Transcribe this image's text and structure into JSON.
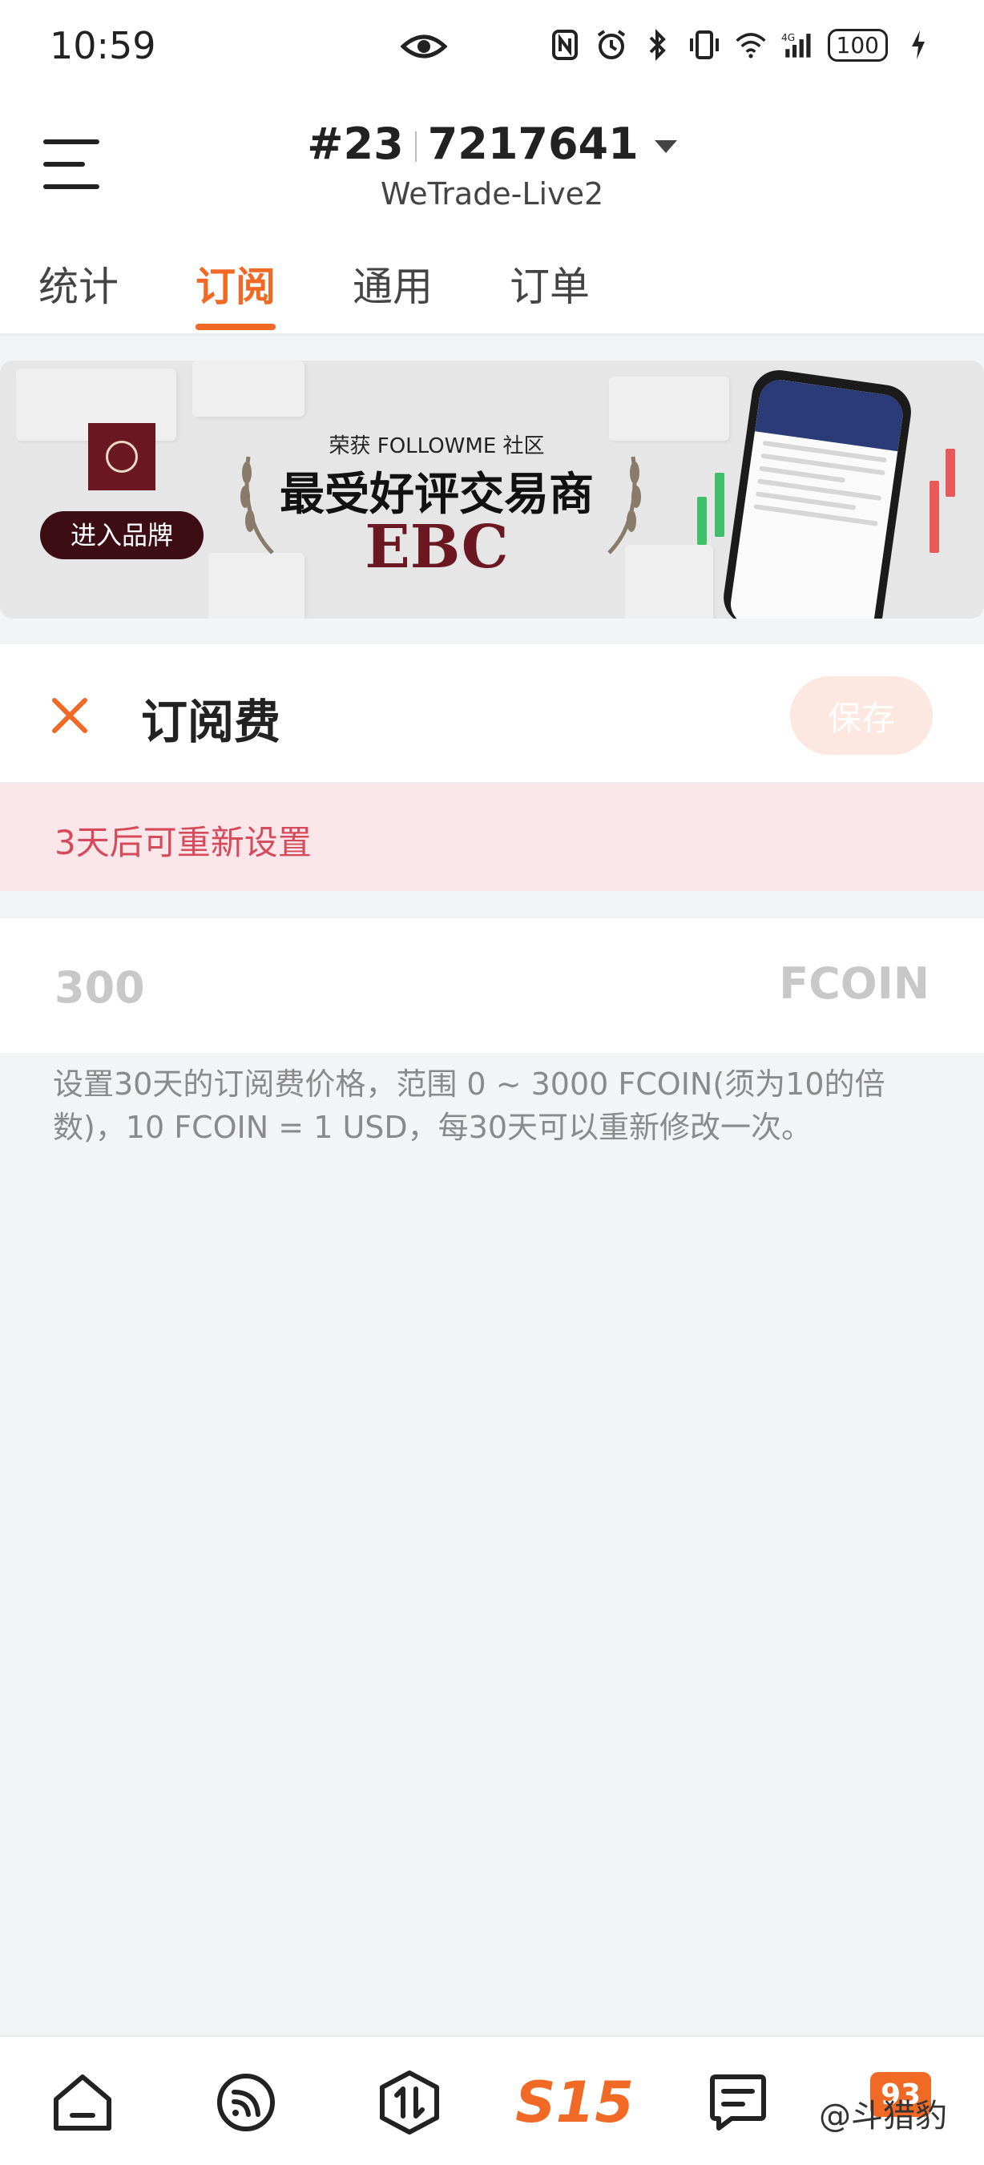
{
  "status_bar": {
    "time": "10:59",
    "battery": "100"
  },
  "header": {
    "account_id_prefix": "#23",
    "account_id": "7217641",
    "server": "WeTrade-Live2"
  },
  "tabs": [
    {
      "label": "统计"
    },
    {
      "label": "订阅"
    },
    {
      "label": "通用"
    },
    {
      "label": "订单"
    }
  ],
  "banner": {
    "brand_button": "进入品牌",
    "award_subtitle": "荣获 FOLLOWME 社区",
    "award_title": "最受好评交易商",
    "brand": "EBC"
  },
  "fee_panel": {
    "title": "订阅费",
    "save_label": "保存",
    "notice": "3天后可重新设置",
    "fee_value": "300",
    "unit": "FCOIN",
    "helper_text": "设置30天的订阅费价格，范围 0 ~ 3000 FCOIN(须为10的倍数)，10 FCOIN = 1 USD，每30天可以重新修改一次。"
  },
  "bottom_nav": {
    "s15_label": "S15",
    "last_badge": "93"
  },
  "watermark": "@斗猎豹",
  "colors": {
    "accent": "#f06a26",
    "notice_bg": "#fbe7ea",
    "notice_text": "#d64b5c",
    "save_bg": "#fde7e1"
  }
}
